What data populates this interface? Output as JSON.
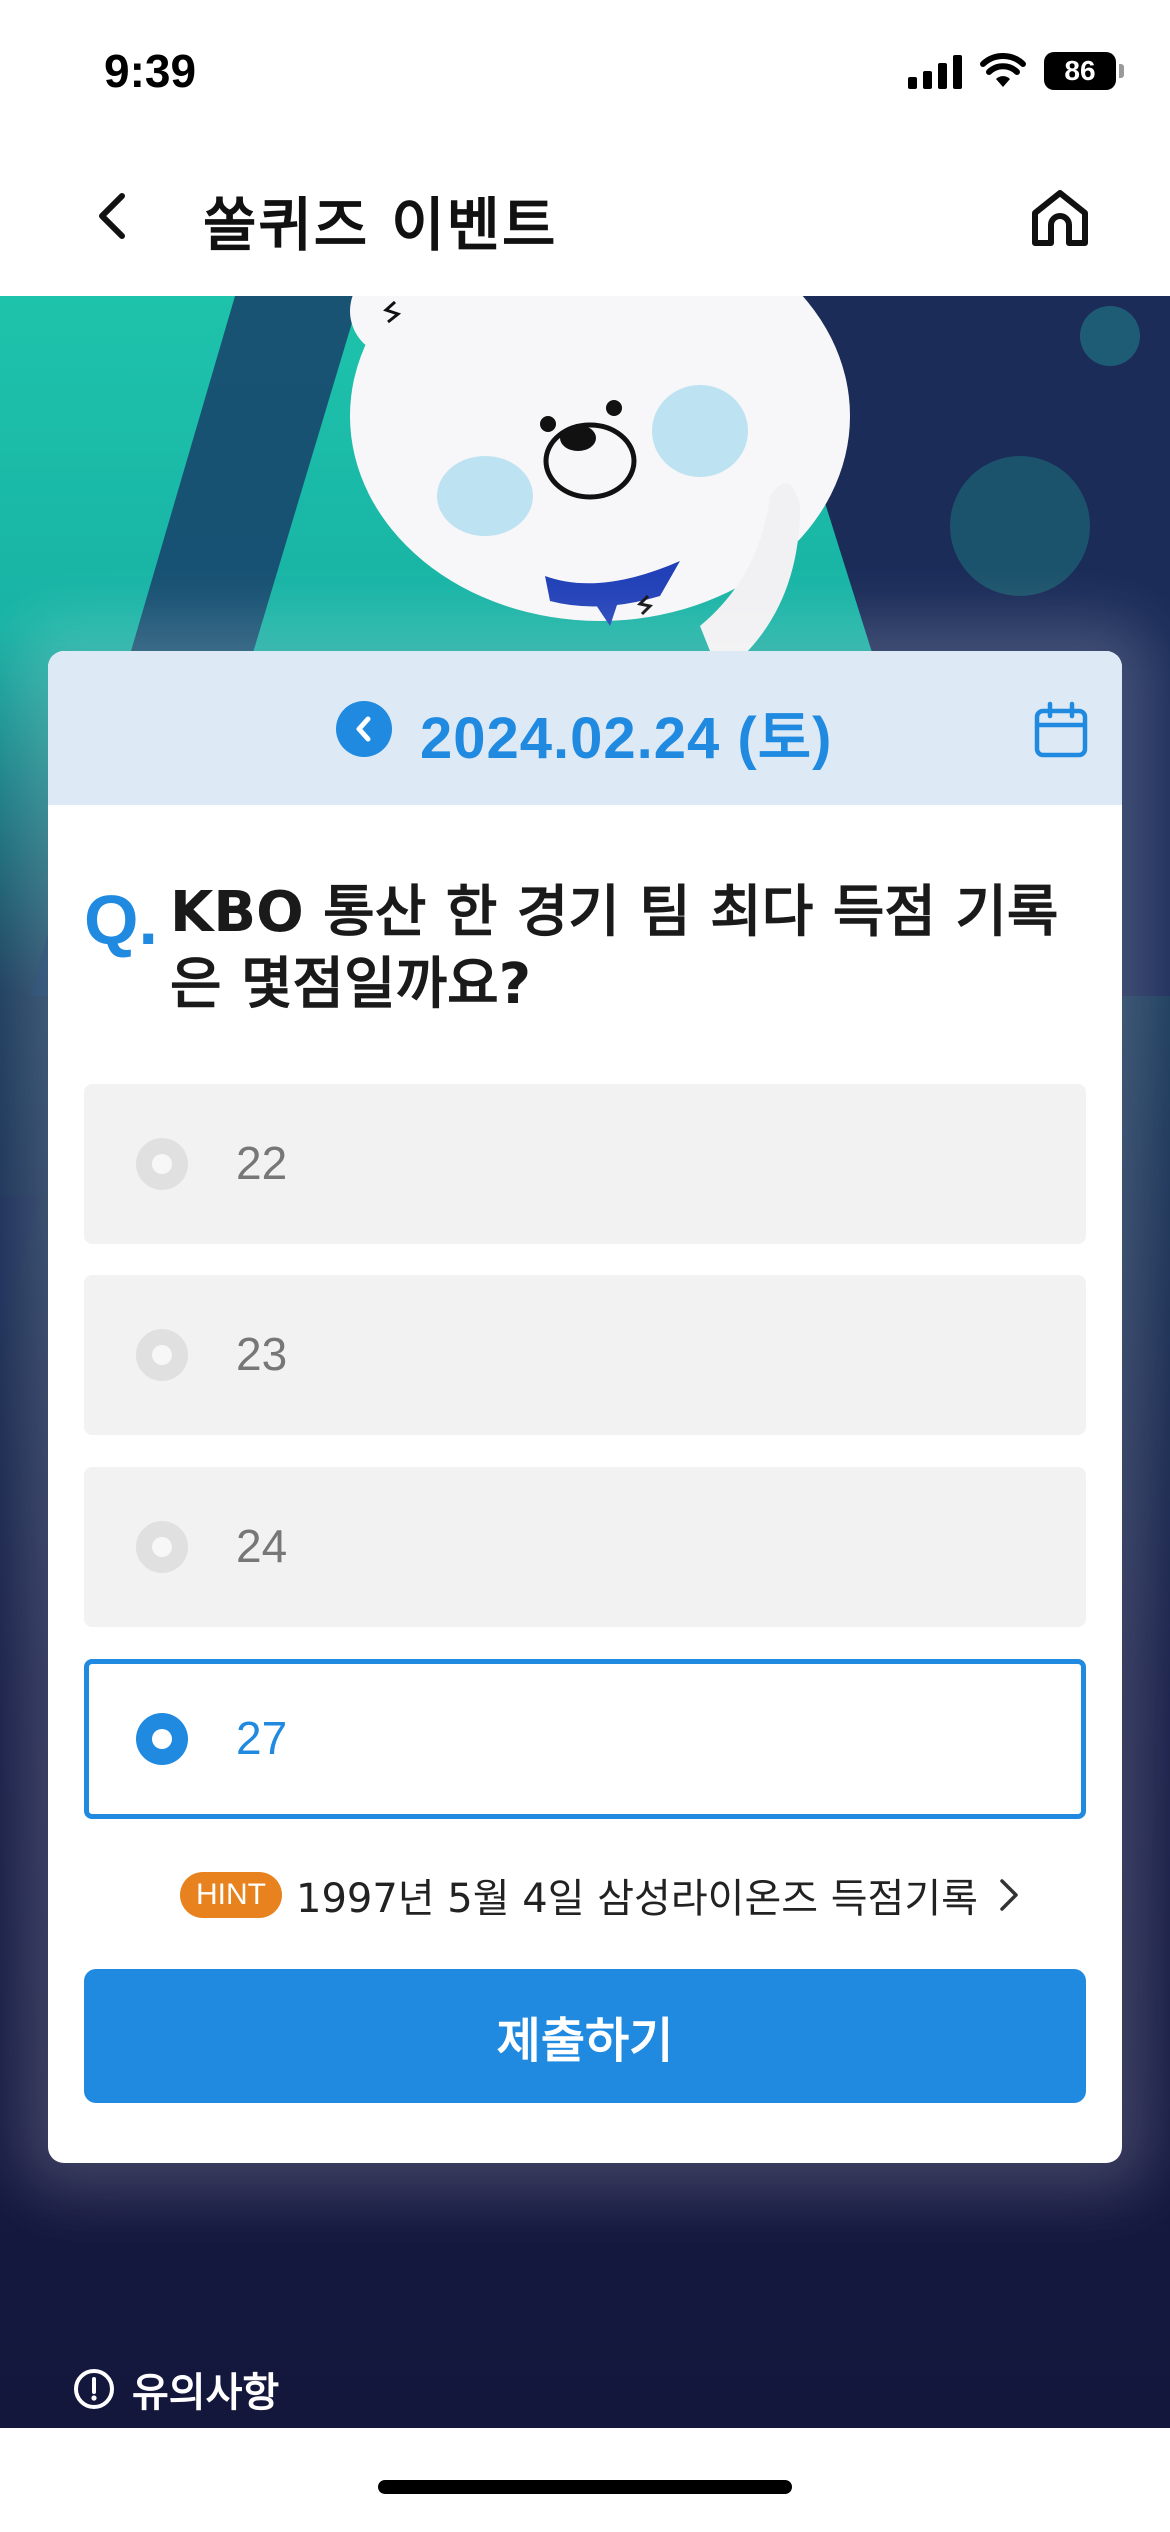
{
  "status": {
    "time": "9:39",
    "battery": "86"
  },
  "nav": {
    "title": "쏠퀴즈 이벤트"
  },
  "quiz": {
    "date": "2024.02.24 (토)",
    "q_mark": "Q.",
    "question": "KBO 통산 한 경기 팀 최다 득점 기록은 몇점일까요?",
    "options": [
      {
        "label": "22",
        "selected": false
      },
      {
        "label": "23",
        "selected": false
      },
      {
        "label": "24",
        "selected": false
      },
      {
        "label": "27",
        "selected": true
      }
    ],
    "hint_badge": "HINT",
    "hint_text": "1997년 5월 4일 삼성라이온즈 득점기록",
    "submit_label": "제출하기"
  },
  "footer": {
    "notice_label": "유의사항"
  },
  "colors": {
    "accent": "#1f8ae0",
    "hint": "#e8821e",
    "hero_top": "#1ec3ab",
    "hero_bottom": "#14173c"
  }
}
